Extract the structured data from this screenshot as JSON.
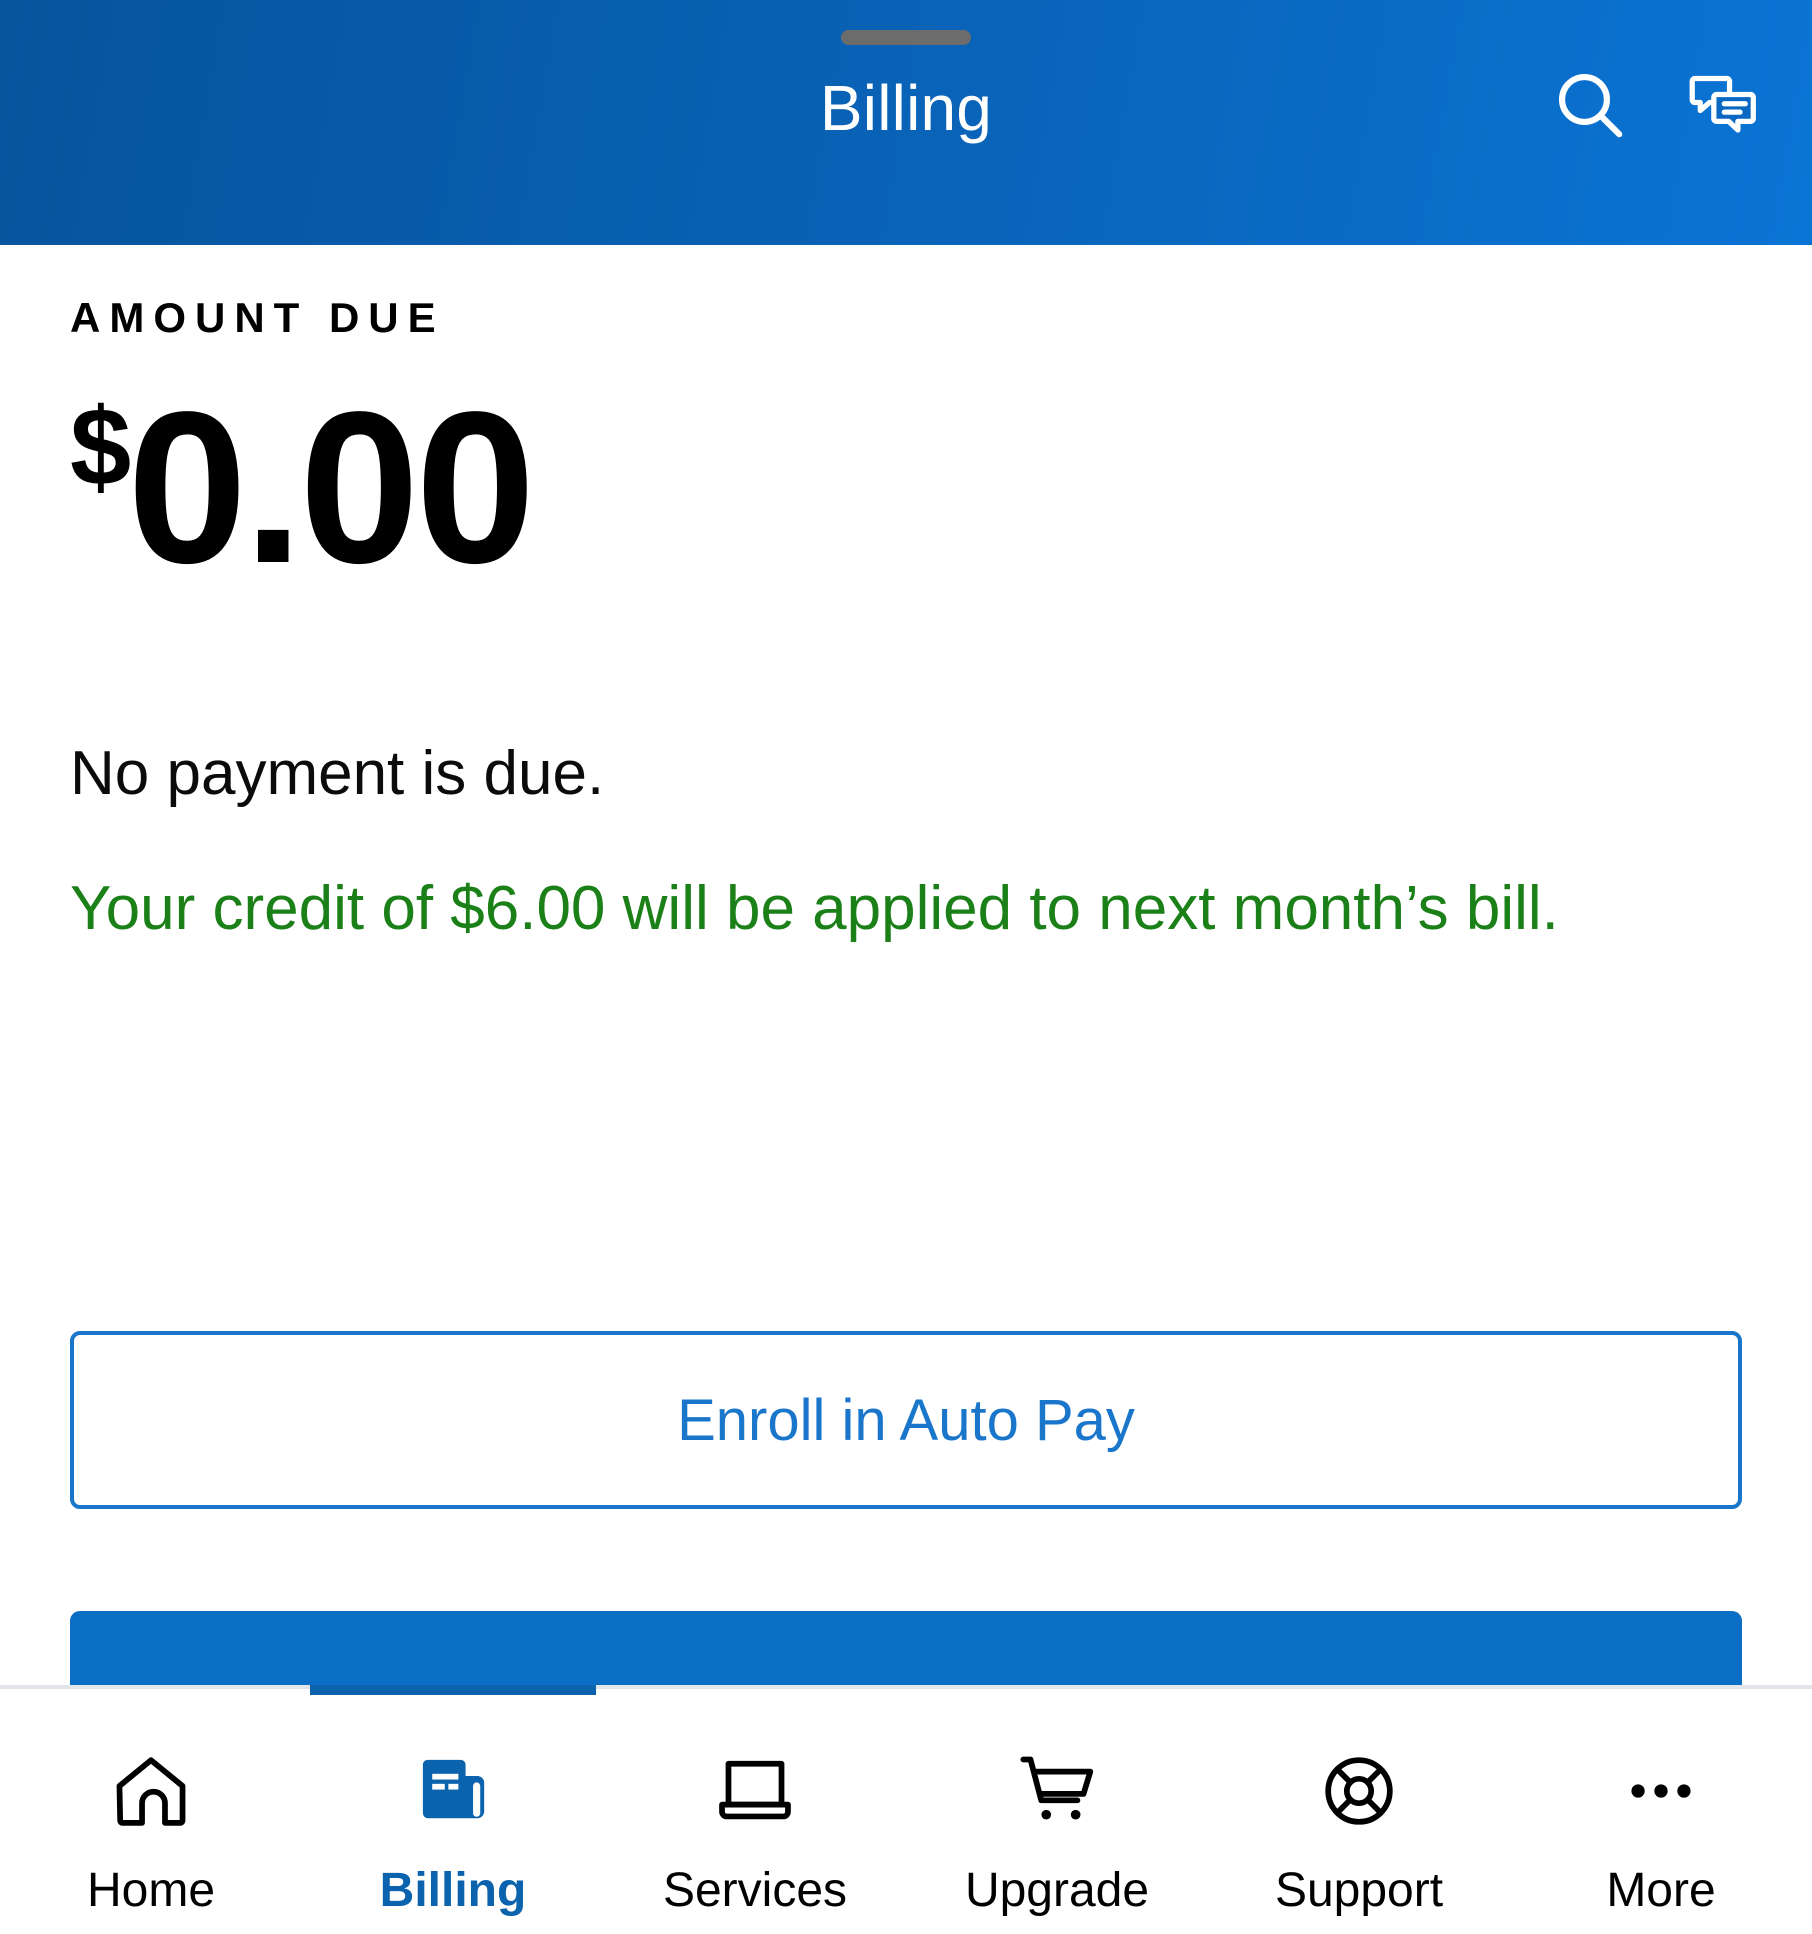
{
  "header": {
    "title": "Billing",
    "drag_handle": "drag-handle",
    "search_icon": "search-icon",
    "chat_icon": "chat-icon",
    "gradient_start": "#05549c",
    "gradient_end": "#0a74d4"
  },
  "billing": {
    "amount_label": "AMOUNT DUE",
    "currency_symbol": "$",
    "amount": "0.00",
    "status_text": "No payment is due.",
    "credit_text": "Your credit of $6.00 will be applied to next month’s bill.",
    "credit_color": "#1a8017",
    "primary_outline_button": "Enroll in Auto Pay",
    "secondary_filled_button": "",
    "accent_color": "#1976ca"
  },
  "bottom_nav": {
    "active_index": 1,
    "active_color": "#0b62ad",
    "items": [
      {
        "label": "Home",
        "icon": "home-icon"
      },
      {
        "label": "Billing",
        "icon": "bill-document-icon"
      },
      {
        "label": "Services",
        "icon": "laptop-icon"
      },
      {
        "label": "Upgrade",
        "icon": "shopping-cart-icon"
      },
      {
        "label": "Support",
        "icon": "lifebuoy-icon"
      },
      {
        "label": "More",
        "icon": "ellipsis-icon"
      }
    ]
  }
}
